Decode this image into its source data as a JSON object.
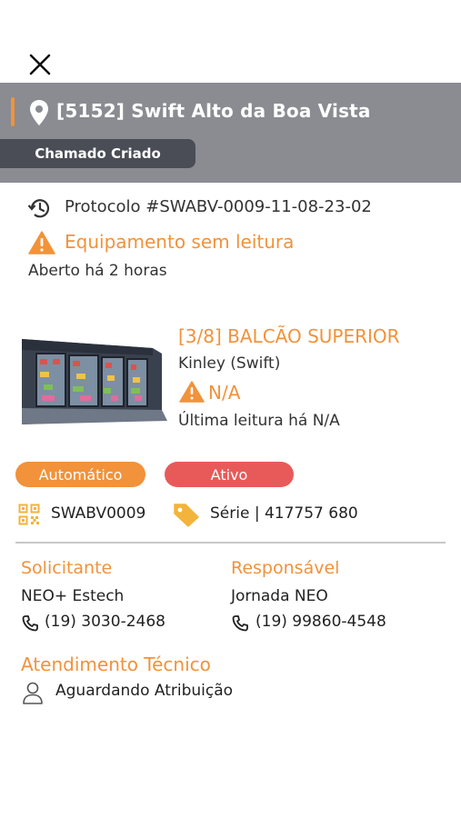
{
  "header": {
    "store_title": "[5152] Swift Alto da Boa Vista",
    "status_chip": "Chamado Criado"
  },
  "ticket": {
    "protocol": "Protocolo #SWABV-0009-11-08-23-02",
    "warning": "Equipamento sem leitura",
    "opened": "Aberto há 2 horas"
  },
  "equipment": {
    "title": "[3/8] BALCÃO SUPERIOR",
    "brand": "Kinley (Swift)",
    "reading": "N/A",
    "last_reading": "Última leitura há N/A",
    "mode_label": "Automático",
    "state_label": "Ativo",
    "code": "SWABV0009",
    "serial": "Série | 417757 680"
  },
  "requester": {
    "heading": "Solicitante",
    "name": "NEO+ Estech",
    "phone": "(19) 3030-2468"
  },
  "responsible": {
    "heading": "Responsável",
    "name": "Jornada NEO",
    "phone": "(19) 99860-4548"
  },
  "technical": {
    "heading": "Atendimento Técnico",
    "status": "Aguardando Atribuição"
  },
  "colors": {
    "accent": "#f2923a",
    "header_bg": "#8a8c92",
    "chip_bg": "#4a4d55",
    "active_red": "#e85a5a"
  },
  "icons": [
    "close-icon",
    "location-pin-icon",
    "history-icon",
    "warning-icon",
    "qr-code-icon",
    "tag-icon",
    "phone-icon",
    "user-icon"
  ]
}
